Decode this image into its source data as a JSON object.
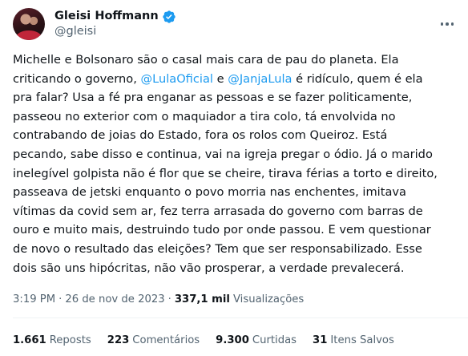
{
  "author": {
    "display_name": "Gleisi Hoffmann",
    "handle": "@gleisi",
    "verified_icon": "verified-badge-icon",
    "verified_color": "#1d9bf0"
  },
  "tweet": {
    "lines": [
      [
        {
          "t": "Michelle e Bolsonaro são o casal mais cara de pau do planeta. Ela"
        }
      ],
      [
        {
          "t": "criticando o governo, "
        },
        {
          "t": "@LulaOficial",
          "m": true
        },
        {
          "t": " e "
        },
        {
          "t": "@JanjaLula",
          "m": true
        },
        {
          "t": " é ridículo, quem é ela"
        }
      ],
      [
        {
          "t": "pra falar? Usa a fé pra enganar as pessoas e se fazer politicamente,"
        }
      ],
      [
        {
          "t": "passeou no exterior com o maquiador a tira colo, tá envolvida no"
        }
      ],
      [
        {
          "t": "contrabando de joias do Estado, fora os rolos com Queiroz. Está"
        }
      ],
      [
        {
          "t": "pecando, sabe disso e continua, vai na igreja pregar o ódio. Já o marido"
        }
      ],
      [
        {
          "t": "inelegível golpista não é flor que se cheire, tirava férias a torto e direito,"
        }
      ],
      [
        {
          "t": "passeava de jetski enquanto o povo morria nas enchentes, imitava"
        }
      ],
      [
        {
          "t": "vítimas da covid sem ar, fez terra arrasada do governo com barras de"
        }
      ],
      [
        {
          "t": "ouro e muito mais, destruindo tudo por onde passou. E vem questionar"
        }
      ],
      [
        {
          "t": "de novo o resultado das eleições? Tem que ser responsabilizado. Esse"
        }
      ],
      [
        {
          "t": "dois são uns hipócritas, não vão prosperar, a verdade prevalecerá."
        }
      ]
    ],
    "mention_color": "#1d9bf0"
  },
  "meta": {
    "time": "3:19 PM",
    "separator": "·",
    "date": "26 de nov de 2023",
    "views_count": "337,1 mil",
    "views_label": "Visualizações"
  },
  "stats": [
    {
      "key": "reposts",
      "num": "1.661",
      "label": "Reposts"
    },
    {
      "key": "comments",
      "num": "223",
      "label": "Comentários"
    },
    {
      "key": "likes",
      "num": "9.300",
      "label": "Curtidas"
    },
    {
      "key": "bookmarks",
      "num": "31",
      "label": "Itens Salvos"
    }
  ]
}
